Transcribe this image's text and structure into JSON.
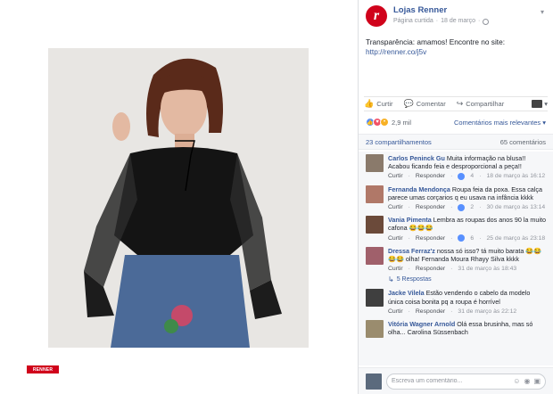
{
  "colors": {
    "brand": "#d0021b",
    "link": "#365899"
  },
  "photo": {
    "watermark": "RENNER"
  },
  "post": {
    "page_name": "Lojas Renner",
    "page_status": "Página curtida",
    "date": "18 de março",
    "text": "Transparência: amamos! Encontre no site: ",
    "link": "http://renner.co/j5v"
  },
  "actions": {
    "like": "Curtir",
    "comment": "Comentar",
    "share": "Compartilhar"
  },
  "reactions": {
    "count": "2,9 mil",
    "sort": "Comentários mais relevantes"
  },
  "counts": {
    "shares": "23 compartilhamentos",
    "comments": "65 comentários"
  },
  "comments": [
    {
      "author": "Carlos Peninck Gu",
      "text": "Muita informação na blusa!! Acabou ficando feia e desproporcional a peça!!",
      "likes": "4",
      "time": "18 de março às 16:12",
      "avatar_color": "#8a7a6b"
    },
    {
      "author": "Fernanda Mendonça",
      "text": "Roupa feia da poxa. Essa calça parece umas corçarios q eu usava na infância kkkk",
      "likes": "2",
      "time": "30 de março às 13:14",
      "avatar_color": "#b07868"
    },
    {
      "author": "Vania Pimenta",
      "text": "Lembra as roupas dos anos 90 la muito cafona 😂😂😂",
      "likes": "6",
      "time": "25 de março às 23:18",
      "avatar_color": "#6b4a3a"
    },
    {
      "author": "Dressa Ferraz'z",
      "text": "nossa só isso? tá muito barata 😂😂😂😂 olha! Fernanda Moura Rhayy Silva kkkk",
      "likes": "",
      "time": "31 de março às 18:43",
      "avatar_color": "#a0606b"
    },
    {
      "author": "Jacke Vilela",
      "text": "Estão vendendo o cabelo da modelo única coisa bonita pq a roupa é horrível",
      "likes": "",
      "time": "31 de março às 22:12",
      "avatar_color": "#3f3f3f"
    },
    {
      "author": "Vitória Wagner Arnold",
      "text": "Olá essa brusinha, mas só olha... Carolina Süssenbach",
      "likes": "",
      "time": "",
      "avatar_color": "#9a8c6e"
    }
  ],
  "replies_label": "5 Respostas",
  "labels": {
    "like": "Curtir",
    "reply": "Responder"
  },
  "comment_input": {
    "placeholder": "Escreva um comentário..."
  }
}
